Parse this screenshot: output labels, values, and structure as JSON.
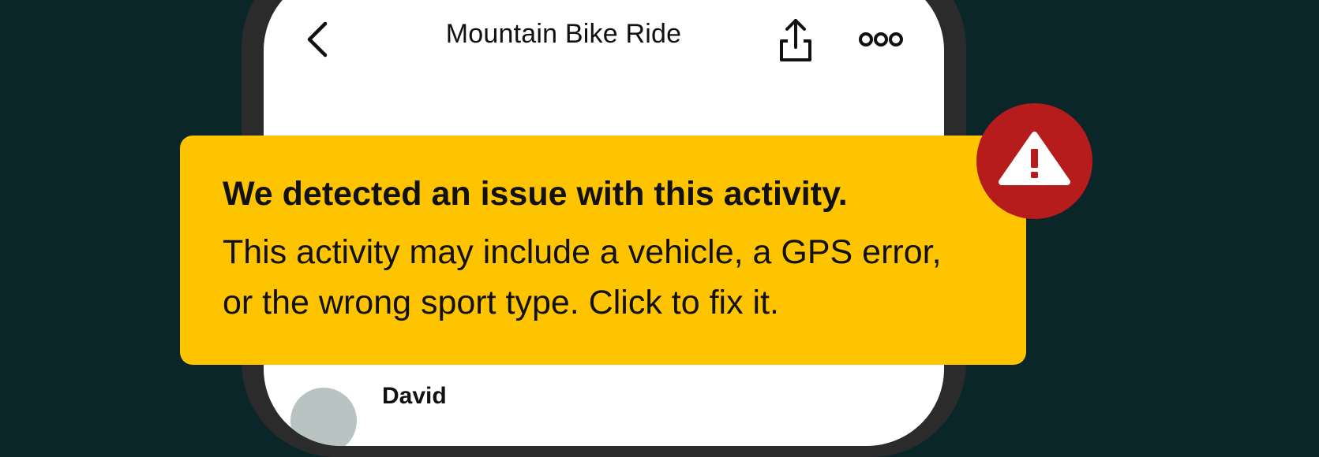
{
  "header": {
    "title": "Mountain Bike Ride"
  },
  "alert": {
    "heading": "We detected an issue with this activity.",
    "body": "This activity may include a vehicle, a GPS error, or the wrong sport type. Click to fix it."
  },
  "athlete": {
    "name": "David"
  },
  "icons": {
    "back": "chevron-left-icon",
    "share": "share-icon",
    "more": "more-options-icon",
    "alert": "warning-triangle-icon"
  },
  "colors": {
    "background": "#0b2628",
    "banner": "#fec400",
    "alert_badge": "#b71c1c"
  }
}
